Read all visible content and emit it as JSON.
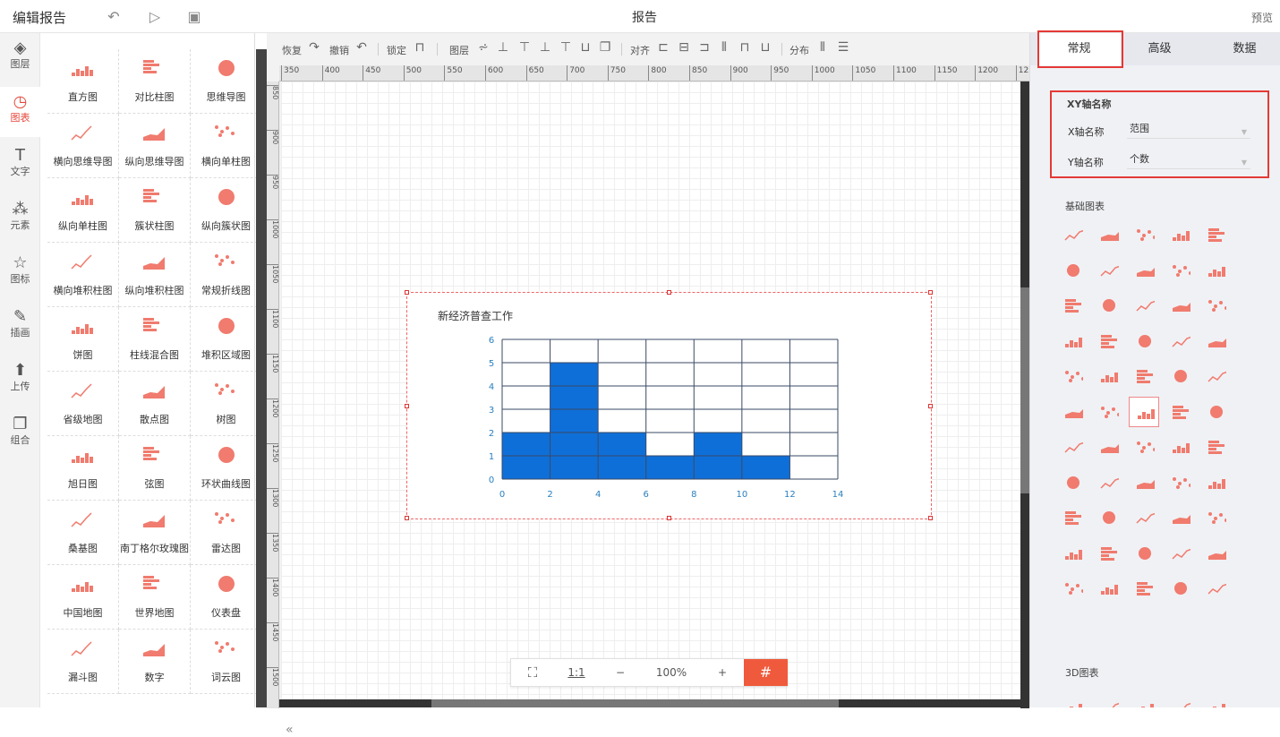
{
  "topbar": {
    "title": "编辑报告",
    "report_title": "报告",
    "preview": "预览"
  },
  "iconbar": [
    {
      "label": "图层",
      "glyph": "◈",
      "icon": "layers-icon"
    },
    {
      "label": "图表",
      "glyph": "◷",
      "icon": "chart-icon",
      "active": true
    },
    {
      "label": "文字",
      "glyph": "T",
      "icon": "text-icon"
    },
    {
      "label": "元素",
      "glyph": "⁂",
      "icon": "elements-icon"
    },
    {
      "label": "图标",
      "glyph": "☆",
      "icon": "star-icon"
    },
    {
      "label": "插画",
      "glyph": "✎",
      "icon": "illustration-icon"
    },
    {
      "label": "上传",
      "glyph": "⬆",
      "icon": "upload-icon"
    },
    {
      "label": "组合",
      "glyph": "❐",
      "icon": "group-icon"
    }
  ],
  "chart_types": [
    "直方图",
    "对比柱图",
    "思维导图",
    "横向思维导图",
    "纵向思维导图",
    "横向单柱图",
    "纵向单柱图",
    "簇状柱图",
    "纵向簇状图",
    "横向堆积柱图",
    "纵向堆积柱图",
    "常规折线图",
    "饼图",
    "柱线混合图",
    "堆积区域图",
    "省级地图",
    "散点图",
    "树图",
    "旭日图",
    "弦图",
    "环状曲线图",
    "桑基图",
    "南丁格尔玫瑰图",
    "雷达图",
    "中国地图",
    "世界地图",
    "仪表盘",
    "漏斗图",
    "数字",
    "词云图"
  ],
  "toolbar": {
    "redo": "恢复",
    "undo": "撤销",
    "lock": "锁定",
    "layer": "图层",
    "align": "对齐",
    "distribute": "分布"
  },
  "ruler_top": [
    "350",
    "400",
    "450",
    "500",
    "550",
    "600",
    "650",
    "700",
    "750",
    "800",
    "850",
    "900",
    "950",
    "1000",
    "1050",
    "1100",
    "1150",
    "1200",
    "1250"
  ],
  "ruler_left": [
    "850",
    "900",
    "950",
    "1000",
    "1050",
    "1100",
    "1150",
    "1200",
    "1250",
    "1300",
    "1350",
    "1400",
    "1450",
    "1500"
  ],
  "zoom": {
    "ratio": "1:1",
    "minus": "−",
    "value": "100%",
    "plus": "+"
  },
  "chart_data": {
    "type": "bar",
    "title": "新经济普查工作",
    "xlabel": "",
    "ylabel": "",
    "x_ticks": [
      0,
      2,
      4,
      6,
      8,
      10,
      12,
      14
    ],
    "y_ticks": [
      0,
      1,
      2,
      3,
      4,
      5,
      6
    ],
    "xlim": [
      0,
      14
    ],
    "ylim": [
      0,
      6
    ],
    "bins": [
      {
        "x0": 0,
        "x1": 2,
        "value": 2
      },
      {
        "x0": 2,
        "x1": 4,
        "value": 5
      },
      {
        "x0": 4,
        "x1": 6,
        "value": 2
      },
      {
        "x0": 6,
        "x1": 8,
        "value": 1
      },
      {
        "x0": 8,
        "x1": 10,
        "value": 2
      },
      {
        "x0": 10,
        "x1": 12,
        "value": 1
      },
      {
        "x0": 12,
        "x1": 14,
        "value": 0
      }
    ],
    "bar_color": "#0f6fd8",
    "grid": true
  },
  "right_panel": {
    "tabs": [
      "常规",
      "高级",
      "数据"
    ],
    "active_tab": "常规",
    "xy_section_title": "XY轴名称",
    "x_axis_label": "X轴名称",
    "x_axis_value": "范围",
    "y_axis_label": "Y轴名称",
    "y_axis_value": "个数",
    "basic_charts_title": "基础图表",
    "charts_3d_title": "3D图表"
  },
  "colors": {
    "accent": "#e5483c",
    "highlight": "#e53935",
    "bar": "#0f6fd8",
    "icon": "#f07b6e"
  }
}
